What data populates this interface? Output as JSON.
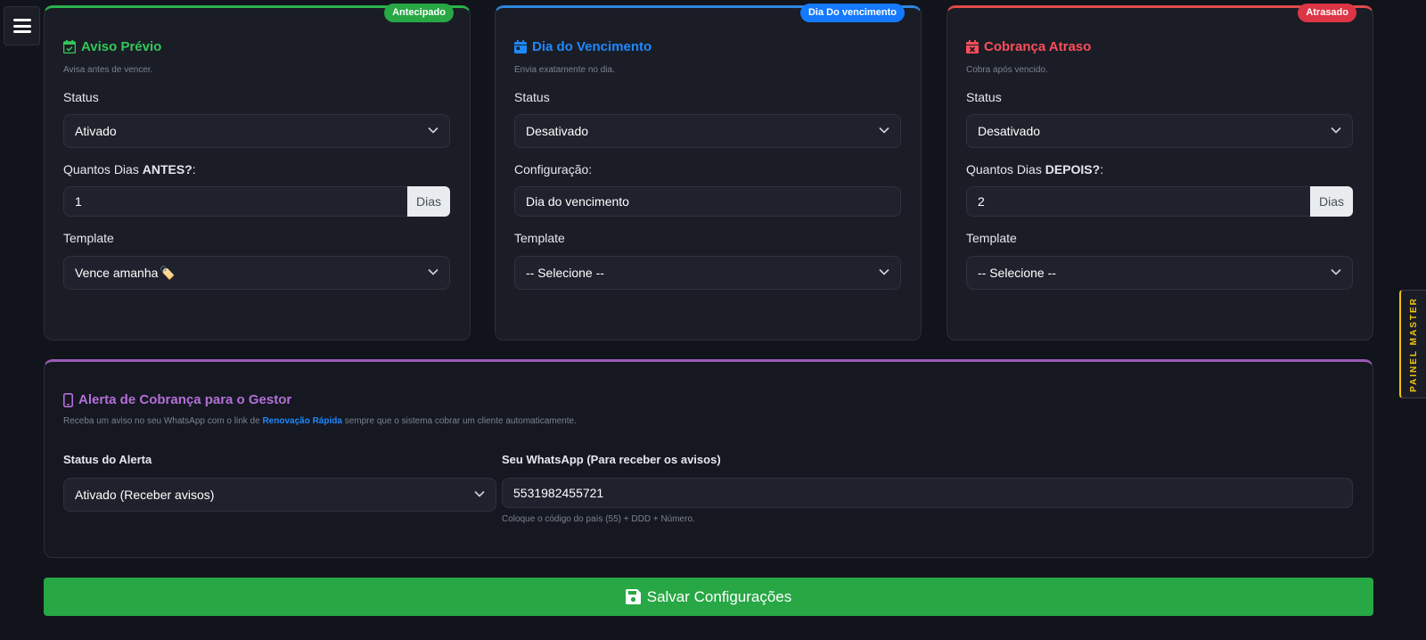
{
  "cards": [
    {
      "badge": "Antecipado",
      "title": "Aviso Prévio",
      "subtitle": "Avisa antes de vencer.",
      "status_label": "Status",
      "status_value": "Ativado",
      "days_label_prefix": "Quantos Dias ",
      "days_label_bold": "ANTES?",
      "days_label_suffix": ":",
      "days_value": "1",
      "days_addon": "Dias",
      "template_label": "Template",
      "template_value": "Vence amanha",
      "template_emoji": "🏷️"
    },
    {
      "badge": "Dia Do vencimento",
      "title": "Dia do Vencimento",
      "subtitle": "Envia exatamente no dia.",
      "status_label": "Status",
      "status_value": "Desativado",
      "config_label": "Configuração:",
      "config_value": "Dia do vencimento",
      "template_label": "Template",
      "template_value": "-- Selecione --"
    },
    {
      "badge": "Atrasado",
      "title": "Cobrança Atraso",
      "subtitle": "Cobra após vencido.",
      "status_label": "Status",
      "status_value": "Desativado",
      "days_label_prefix": "Quantos Dias ",
      "days_label_bold": "DEPOIS?",
      "days_label_suffix": ":",
      "days_value": "2",
      "days_addon": "Dias",
      "template_label": "Template",
      "template_value": "-- Selecione --"
    }
  ],
  "alert": {
    "title": "Alerta de Cobrança para o Gestor",
    "desc_before": "Receba um aviso no seu WhatsApp com o link de ",
    "desc_link": "Renovação Rápida",
    "desc_after": " sempre que o sistema cobrar um cliente automaticamente.",
    "status_label": "Status do Alerta",
    "status_value": "Ativado (Receber avisos)",
    "whatsapp_label": "Seu WhatsApp (Para receber os avisos)",
    "whatsapp_value": "5531982455721",
    "whatsapp_help": "Coloque o código do país (55) + DDD + Número."
  },
  "save_button": "Salvar Configurações",
  "side_tab": "PAINEL MASTER",
  "colors": {
    "green": "#28a745",
    "blue": "#1479ff",
    "red": "#dc3545",
    "purple": "#9b59b6",
    "gold": "#f1c40f"
  }
}
